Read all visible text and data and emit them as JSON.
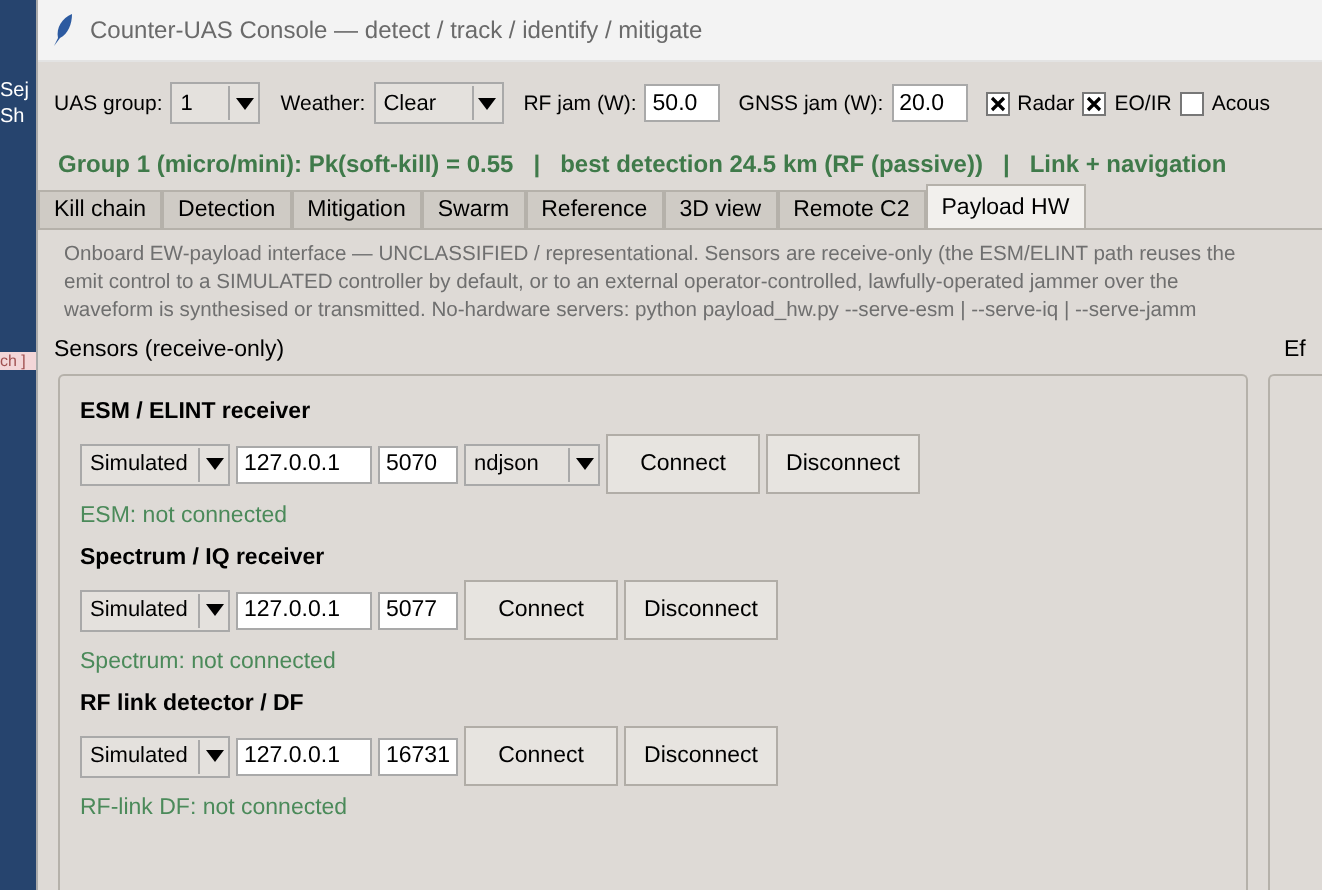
{
  "desktop": {
    "fragments": [
      "Sej",
      "Sh",
      "ch ]"
    ]
  },
  "window": {
    "title": "Counter-UAS Console — detect / track / identify / mitigate"
  },
  "toolbar": {
    "uas_group": {
      "label": "UAS group:",
      "value": "1"
    },
    "weather": {
      "label": "Weather:",
      "value": "Clear"
    },
    "rf_jam": {
      "label": "RF jam (W):",
      "value": "50.0"
    },
    "gnss_jam": {
      "label": "GNSS jam (W):",
      "value": "20.0"
    },
    "sensors": [
      {
        "label": "Radar",
        "checked": true
      },
      {
        "label": "EO/IR",
        "checked": true
      },
      {
        "label": "Acous",
        "checked": false
      }
    ]
  },
  "status": "Group 1 (micro/mini): Pk(soft-kill) = 0.55   |   best detection 24.5 km (RF (passive))   |   Link + navigation",
  "tabs": [
    {
      "label": "Kill chain",
      "selected": false
    },
    {
      "label": "Detection",
      "selected": false
    },
    {
      "label": "Mitigation",
      "selected": false
    },
    {
      "label": "Swarm",
      "selected": false
    },
    {
      "label": "Reference",
      "selected": false
    },
    {
      "label": "3D view",
      "selected": false
    },
    {
      "label": "Remote C2",
      "selected": false
    },
    {
      "label": "Payload HW",
      "selected": true
    }
  ],
  "description": [
    "Onboard EW-payload interface — UNCLASSIFIED / representational. Sensors are receive-only (the ESM/ELINT path reuses the",
    "emit control to a SIMULATED controller by default, or to an external operator-controlled, lawfully-operated jammer over the",
    "waveform is synthesised or transmitted. No-hardware servers: python payload_hw.py --serve-esm | --serve-iq | --serve-jamm"
  ],
  "sensors_panel": {
    "title": "Sensors (receive-only)",
    "receivers": [
      {
        "title": "ESM / ELINT receiver",
        "mode": "Simulated",
        "host": "127.0.0.1",
        "port": "5070",
        "format": "ndjson",
        "connect": "Connect",
        "disconnect": "Disconnect",
        "status": "ESM: not connected"
      },
      {
        "title": "Spectrum / IQ receiver",
        "mode": "Simulated",
        "host": "127.0.0.1",
        "port": "5077",
        "connect": "Connect",
        "disconnect": "Disconnect",
        "status": "Spectrum: not connected"
      },
      {
        "title": "RF link detector / DF",
        "mode": "Simulated",
        "host": "127.0.0.1",
        "port": "16731",
        "connect": "Connect",
        "disconnect": "Disconnect",
        "status": "RF-link DF: not connected"
      }
    ]
  },
  "right_panel": {
    "title": "Ef"
  }
}
